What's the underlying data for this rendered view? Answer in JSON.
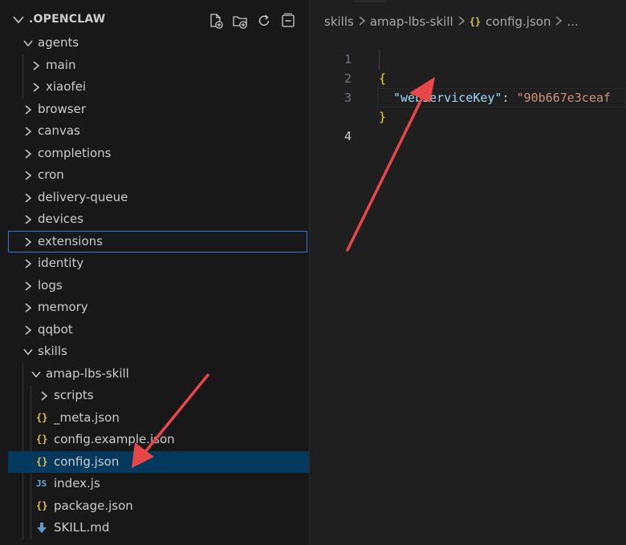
{
  "explorer": {
    "root_title": ".OPENCLAW",
    "toolbar": {
      "new_file_icon": "new-file-icon",
      "new_folder_icon": "new-folder-icon",
      "refresh_icon": "refresh-icon",
      "collapse_all_icon": "collapse-all-icon"
    },
    "items": [
      {
        "label": "agents",
        "type": "folder",
        "open": true,
        "depth": 1
      },
      {
        "label": "main",
        "type": "folder",
        "open": false,
        "depth": 2
      },
      {
        "label": "xiaofei",
        "type": "folder",
        "open": false,
        "depth": 2
      },
      {
        "label": "browser",
        "type": "folder",
        "open": false,
        "depth": 1
      },
      {
        "label": "canvas",
        "type": "folder",
        "open": false,
        "depth": 1
      },
      {
        "label": "completions",
        "type": "folder",
        "open": false,
        "depth": 1
      },
      {
        "label": "cron",
        "type": "folder",
        "open": false,
        "depth": 1
      },
      {
        "label": "delivery-queue",
        "type": "folder",
        "open": false,
        "depth": 1
      },
      {
        "label": "devices",
        "type": "folder",
        "open": false,
        "depth": 1
      },
      {
        "label": "extensions",
        "type": "folder",
        "open": false,
        "depth": 1,
        "focused": true
      },
      {
        "label": "identity",
        "type": "folder",
        "open": false,
        "depth": 1
      },
      {
        "label": "logs",
        "type": "folder",
        "open": false,
        "depth": 1
      },
      {
        "label": "memory",
        "type": "folder",
        "open": false,
        "depth": 1
      },
      {
        "label": "qqbot",
        "type": "folder",
        "open": false,
        "depth": 1
      },
      {
        "label": "skills",
        "type": "folder",
        "open": true,
        "depth": 1
      },
      {
        "label": "amap-lbs-skill",
        "type": "folder",
        "open": true,
        "depth": 2
      },
      {
        "label": "scripts",
        "type": "folder",
        "open": false,
        "depth": 3
      },
      {
        "label": "_meta.json",
        "type": "json",
        "depth": 3
      },
      {
        "label": "config.example.json",
        "type": "json",
        "depth": 3
      },
      {
        "label": "config.json",
        "type": "json",
        "depth": 3,
        "selected": true
      },
      {
        "label": "index.js",
        "type": "js",
        "depth": 3
      },
      {
        "label": "package.json",
        "type": "json",
        "depth": 3
      },
      {
        "label": "SKILL.md",
        "type": "md",
        "depth": 3
      }
    ]
  },
  "editor": {
    "breadcrumb": {
      "part1": "skills",
      "part2": "amap-lbs-skill",
      "part3": "config.json",
      "more": "..."
    },
    "json_icon_text": "{}",
    "js_icon_text": "JS",
    "lines": [
      {
        "num": "1",
        "brace": "{"
      },
      {
        "num": "2",
        "key": "\"webServiceKey\"",
        "colon": ": ",
        "value": "\"90b667e3ceaf"
      },
      {
        "num": "3",
        "brace": "}"
      },
      {
        "num": "4"
      }
    ]
  },
  "colors": {
    "annotation_arrow": "#e8474a",
    "selection": "#04395e",
    "focus_outline": "#2f7bd3"
  }
}
